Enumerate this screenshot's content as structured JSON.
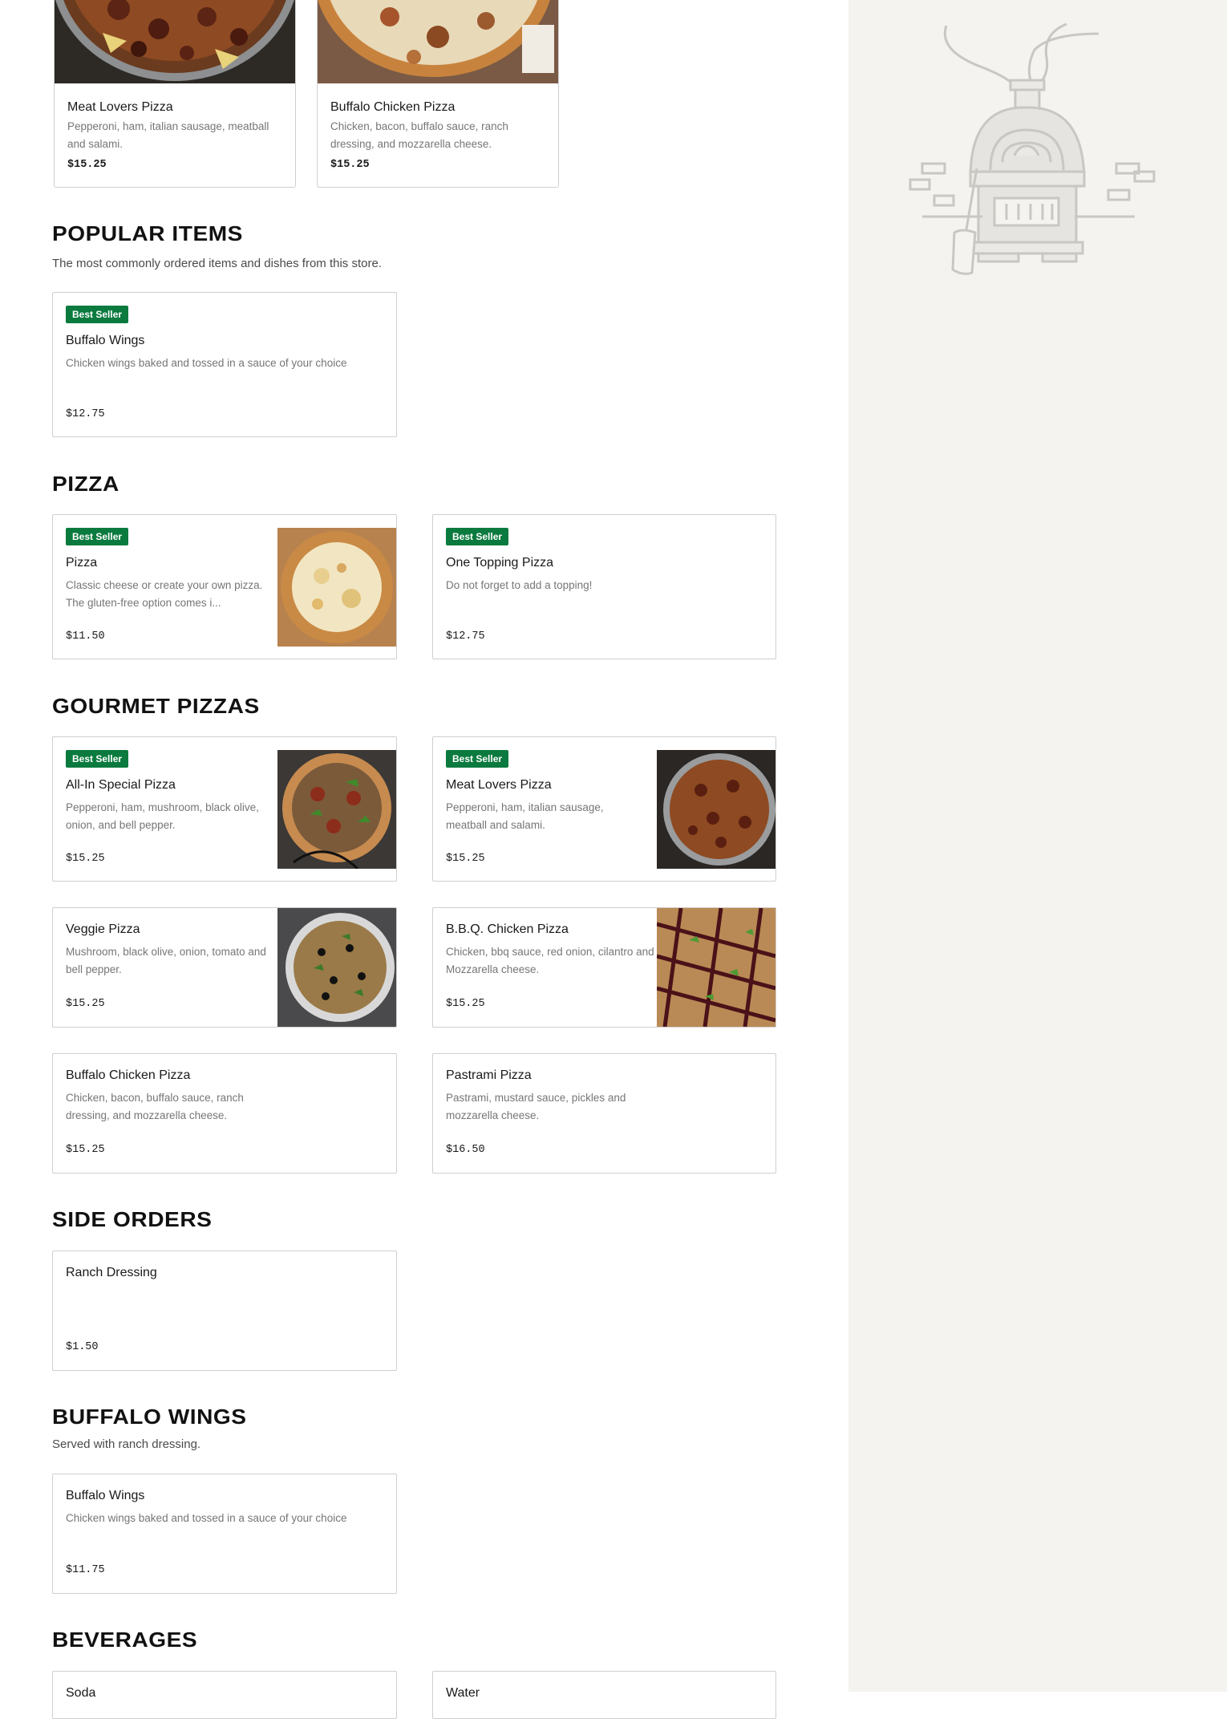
{
  "top_cards": [
    {
      "name": "Meat Lovers Pizza",
      "desc": "Pepperoni, ham, italian sausage, meatball and salami.",
      "price": "$15.25"
    },
    {
      "name": "Buffalo Chicken Pizza",
      "desc": "Chicken, bacon, buffalo sauce, ranch dressing, and mozzarella cheese.",
      "price": "$15.25"
    }
  ],
  "popular": {
    "title": "POPULAR ITEMS",
    "subtitle": "The most commonly ordered items and dishes from this store.",
    "items": [
      {
        "badge": "Best Seller",
        "name": "Buffalo Wings",
        "desc": "Chicken wings baked and tossed in a sauce of your choice",
        "price": "$12.75"
      }
    ]
  },
  "pizza": {
    "title": "PIZZA",
    "items": [
      {
        "badge": "Best Seller",
        "name": "Pizza",
        "desc": "Classic cheese or create your own pizza. The gluten-free option comes i...",
        "price": "$11.50"
      },
      {
        "badge": "Best Seller",
        "name": "One Topping Pizza",
        "desc": "Do not forget to add a topping!",
        "price": "$12.75"
      }
    ]
  },
  "gourmet": {
    "title": "GOURMET PIZZAS",
    "items": [
      {
        "badge": "Best Seller",
        "name": "All-In Special Pizza",
        "desc": "Pepperoni, ham, mushroom, black olive, onion, and bell pepper.",
        "price": "$15.25"
      },
      {
        "badge": "Best Seller",
        "name": "Meat Lovers Pizza",
        "desc": "Pepperoni, ham, italian sausage, meatball and salami.",
        "price": "$15.25"
      },
      {
        "name": "Veggie Pizza",
        "desc": "Mushroom, black olive, onion, tomato and bell pepper.",
        "price": "$15.25"
      },
      {
        "name": "B.B.Q. Chicken Pizza",
        "desc": "Chicken, bbq sauce, red onion, cilantro and Mozzarella cheese.",
        "price": "$15.25"
      },
      {
        "name": "Buffalo Chicken Pizza",
        "desc": "Chicken, bacon, buffalo sauce, ranch dressing, and mozzarella cheese.",
        "price": "$15.25"
      },
      {
        "name": "Pastrami Pizza",
        "desc": "Pastrami, mustard sauce, pickles and mozzarella cheese.",
        "price": "$16.50"
      }
    ]
  },
  "sides": {
    "title": "SIDE ORDERS",
    "items": [
      {
        "name": "Ranch Dressing",
        "price": "$1.50"
      }
    ]
  },
  "wings": {
    "title": "BUFFALO WINGS",
    "subtitle": "Served with ranch dressing.",
    "items": [
      {
        "name": "Buffalo Wings",
        "desc": "Chicken wings baked and tossed in a sauce of your choice",
        "price": "$11.75"
      }
    ]
  },
  "beverages": {
    "title": "BEVERAGES",
    "items": [
      {
        "name": "Soda"
      },
      {
        "name": "Water"
      }
    ]
  },
  "colors": {
    "badge": "#0b7a3e",
    "sidebar": "#f4f3f0",
    "border": "#cfcfcf"
  },
  "icons": [
    "pizza-oven-illustration"
  ]
}
